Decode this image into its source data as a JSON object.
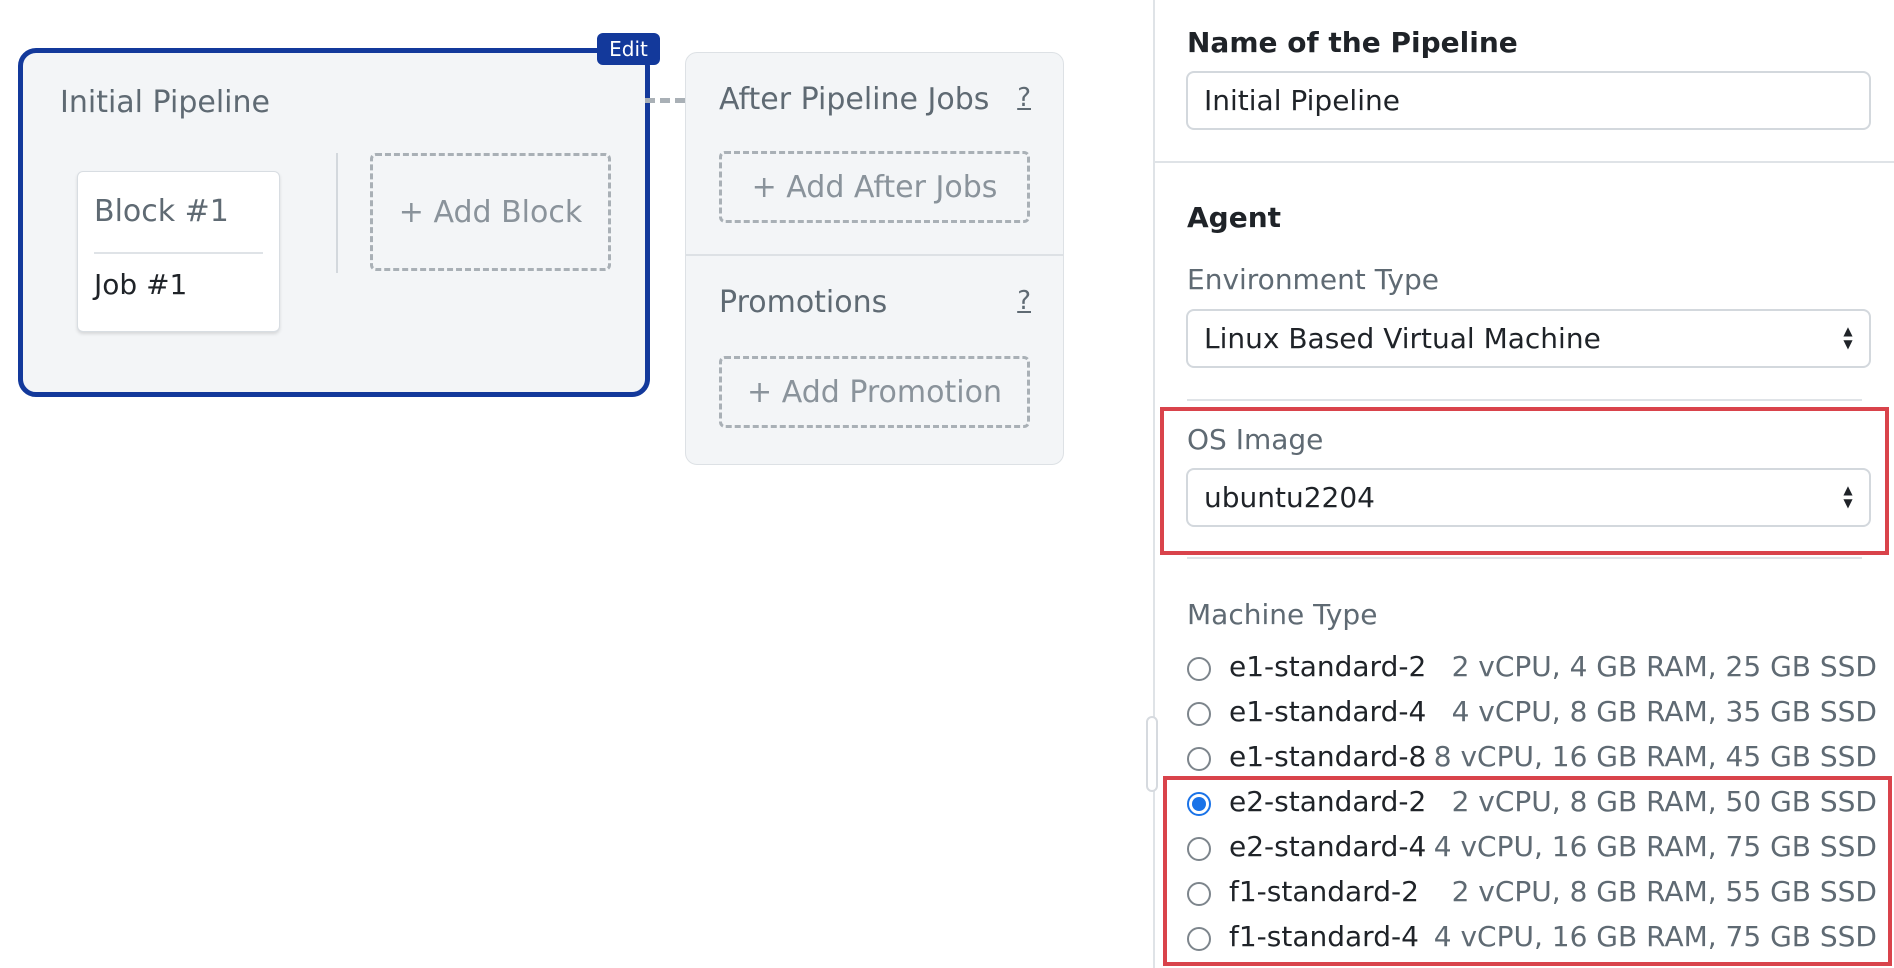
{
  "canvas": {
    "edit_label": "Edit",
    "pipeline_title": "Initial Pipeline",
    "block": {
      "name": "Block #1",
      "job": "Job #1"
    },
    "add_block_label": "+ Add Block",
    "after_jobs": {
      "title": "After Pipeline Jobs",
      "help": "?",
      "add_label": "+ Add After Jobs"
    },
    "promotions": {
      "title": "Promotions",
      "help": "?",
      "add_label": "+ Add Promotion"
    }
  },
  "sidebar": {
    "name_label": "Name of the Pipeline",
    "name_value": "Initial Pipeline",
    "agent_heading": "Agent",
    "environment_label": "Environment Type",
    "environment_value": "Linux Based Virtual Machine",
    "os_image_label": "OS Image",
    "os_image_value": "ubuntu2204",
    "machine_type_label": "Machine Type",
    "machine_types": [
      {
        "name": "e1-standard-2",
        "spec": "2 vCPU, 4 GB RAM, 25 GB SSD",
        "selected": false
      },
      {
        "name": "e1-standard-4",
        "spec": "4 vCPU, 8 GB RAM, 35 GB SSD",
        "selected": false
      },
      {
        "name": "e1-standard-8",
        "spec": "8 vCPU, 16 GB RAM, 45 GB SSD",
        "selected": false
      },
      {
        "name": "e2-standard-2",
        "spec": "2 vCPU, 8 GB RAM, 50 GB SSD",
        "selected": true
      },
      {
        "name": "e2-standard-4",
        "spec": "4 vCPU, 16 GB RAM, 75 GB SSD",
        "selected": false
      },
      {
        "name": "f1-standard-2",
        "spec": "2 vCPU, 8 GB RAM, 55 GB SSD",
        "selected": false
      },
      {
        "name": "f1-standard-4",
        "spec": "4 vCPU, 16 GB RAM, 75 GB SSD",
        "selected": false
      }
    ]
  },
  "colors": {
    "pipeline_border": "#13399b",
    "highlight": "#d9434b",
    "radio_selected": "#1a73e8"
  }
}
